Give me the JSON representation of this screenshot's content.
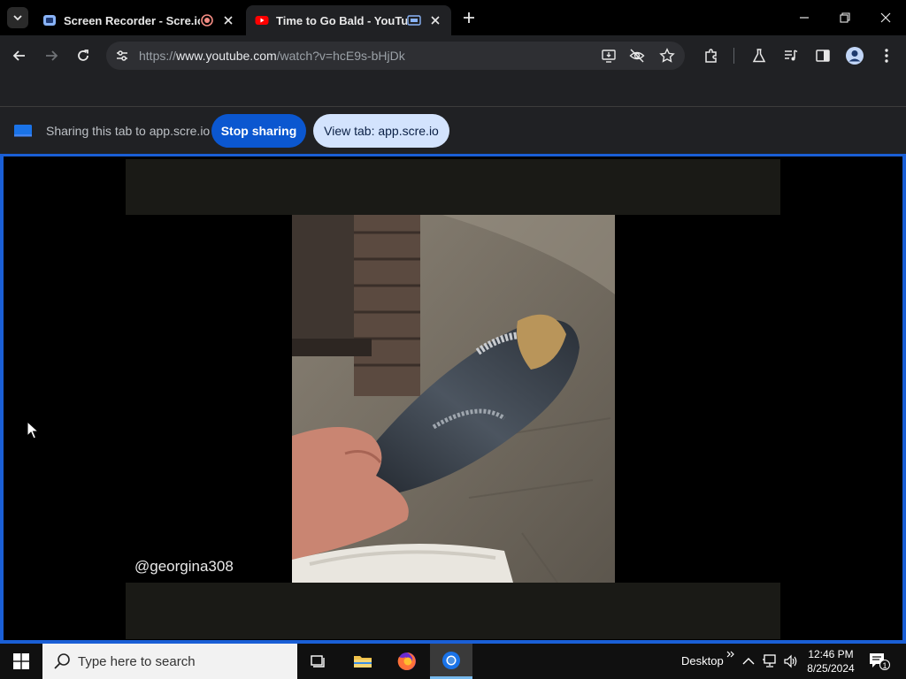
{
  "tabs": [
    {
      "title": "Screen Recorder - Scre.io",
      "recording": true,
      "active": false
    },
    {
      "title": "Time to Go Bald - YouTube",
      "active": true
    }
  ],
  "toolbar": {
    "url_prefix": "https://",
    "url_domain": "www.youtube.com",
    "url_path": "/watch?v=hcE9s-bHjDk"
  },
  "sharebar": {
    "message": "Sharing this tab to app.scre.io",
    "stop_label": "Stop sharing",
    "view_label": "View tab: app.scre.io"
  },
  "video": {
    "watermark": "@georgina308"
  },
  "taskbar": {
    "search_placeholder": "Type here to search",
    "desktop_label": "Desktop",
    "time": "12:46 PM",
    "date": "8/25/2024",
    "notification_count": "1"
  },
  "colors": {
    "accent_blue": "#0b57d0",
    "view_button_bg": "#d3e3fd",
    "share_border": "#1a5fd6",
    "youtube_red": "#ff0000",
    "record_red": "#f28b82"
  }
}
